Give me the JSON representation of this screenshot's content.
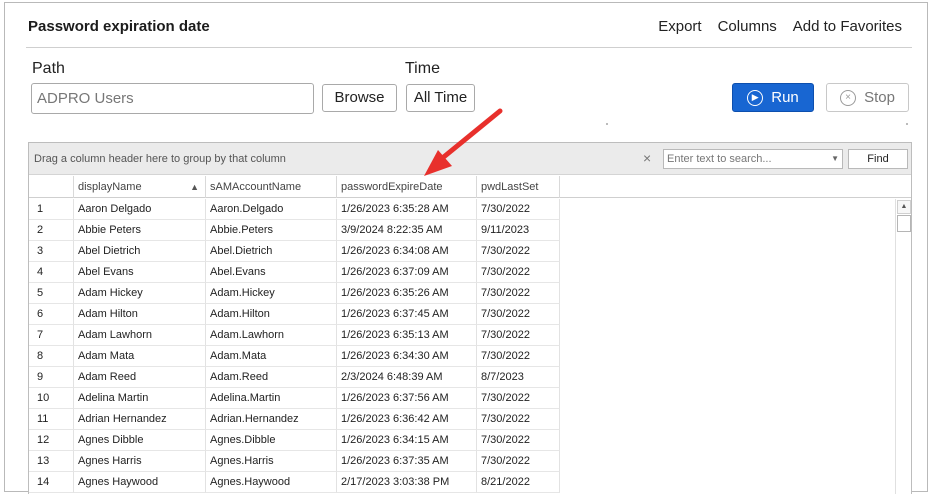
{
  "header": {
    "title": "Password expiration date",
    "links": [
      "Export",
      "Columns",
      "Add to Favorites"
    ]
  },
  "form": {
    "path_label": "Path",
    "path_value": "ADPRO Users",
    "browse_label": "Browse",
    "time_label": "Time",
    "time_value": "All Time",
    "run_label": "Run",
    "stop_label": "Stop"
  },
  "grid": {
    "group_hint": "Drag a column header here to group by that column",
    "search_placeholder": "Enter text to search...",
    "find_label": "Find",
    "columns": [
      "displayName",
      "sAMAccountName",
      "passwordExpireDate",
      "pwdLastSet"
    ],
    "sorted_column": "displayName",
    "rows": [
      {
        "n": "1",
        "displayName": "Aaron Delgado",
        "sam": "Aaron.Delgado",
        "expire": "1/26/2023 6:35:28 AM",
        "pwd": "7/30/2022"
      },
      {
        "n": "2",
        "displayName": "Abbie Peters",
        "sam": "Abbie.Peters",
        "expire": "3/9/2024 8:22:35 AM",
        "pwd": "9/11/2023"
      },
      {
        "n": "3",
        "displayName": "Abel Dietrich",
        "sam": "Abel.Dietrich",
        "expire": "1/26/2023 6:34:08 AM",
        "pwd": "7/30/2022"
      },
      {
        "n": "4",
        "displayName": "Abel Evans",
        "sam": "Abel.Evans",
        "expire": "1/26/2023 6:37:09 AM",
        "pwd": "7/30/2022"
      },
      {
        "n": "5",
        "displayName": "Adam Hickey",
        "sam": "Adam.Hickey",
        "expire": "1/26/2023 6:35:26 AM",
        "pwd": "7/30/2022"
      },
      {
        "n": "6",
        "displayName": "Adam Hilton",
        "sam": "Adam.Hilton",
        "expire": "1/26/2023 6:37:45 AM",
        "pwd": "7/30/2022"
      },
      {
        "n": "7",
        "displayName": "Adam Lawhorn",
        "sam": "Adam.Lawhorn",
        "expire": "1/26/2023 6:35:13 AM",
        "pwd": "7/30/2022"
      },
      {
        "n": "8",
        "displayName": "Adam Mata",
        "sam": "Adam.Mata",
        "expire": "1/26/2023 6:34:30 AM",
        "pwd": "7/30/2022"
      },
      {
        "n": "9",
        "displayName": "Adam Reed",
        "sam": "Adam.Reed",
        "expire": "2/3/2024 6:48:39 AM",
        "pwd": "8/7/2023"
      },
      {
        "n": "10",
        "displayName": "Adelina Martin",
        "sam": "Adelina.Martin",
        "expire": "1/26/2023 6:37:56 AM",
        "pwd": "7/30/2022"
      },
      {
        "n": "11",
        "displayName": "Adrian Hernandez",
        "sam": "Adrian.Hernandez",
        "expire": "1/26/2023 6:36:42 AM",
        "pwd": "7/30/2022"
      },
      {
        "n": "12",
        "displayName": "Agnes Dibble",
        "sam": "Agnes.Dibble",
        "expire": "1/26/2023 6:34:15 AM",
        "pwd": "7/30/2022"
      },
      {
        "n": "13",
        "displayName": "Agnes Harris",
        "sam": "Agnes.Harris",
        "expire": "1/26/2023 6:37:35 AM",
        "pwd": "7/30/2022"
      },
      {
        "n": "14",
        "displayName": "Agnes Haywood",
        "sam": "Agnes.Haywood",
        "expire": "2/17/2023 3:03:38 PM",
        "pwd": "8/21/2022"
      }
    ]
  },
  "accent_color": "#1866d2",
  "annotation_arrow_color": "#e8302c"
}
